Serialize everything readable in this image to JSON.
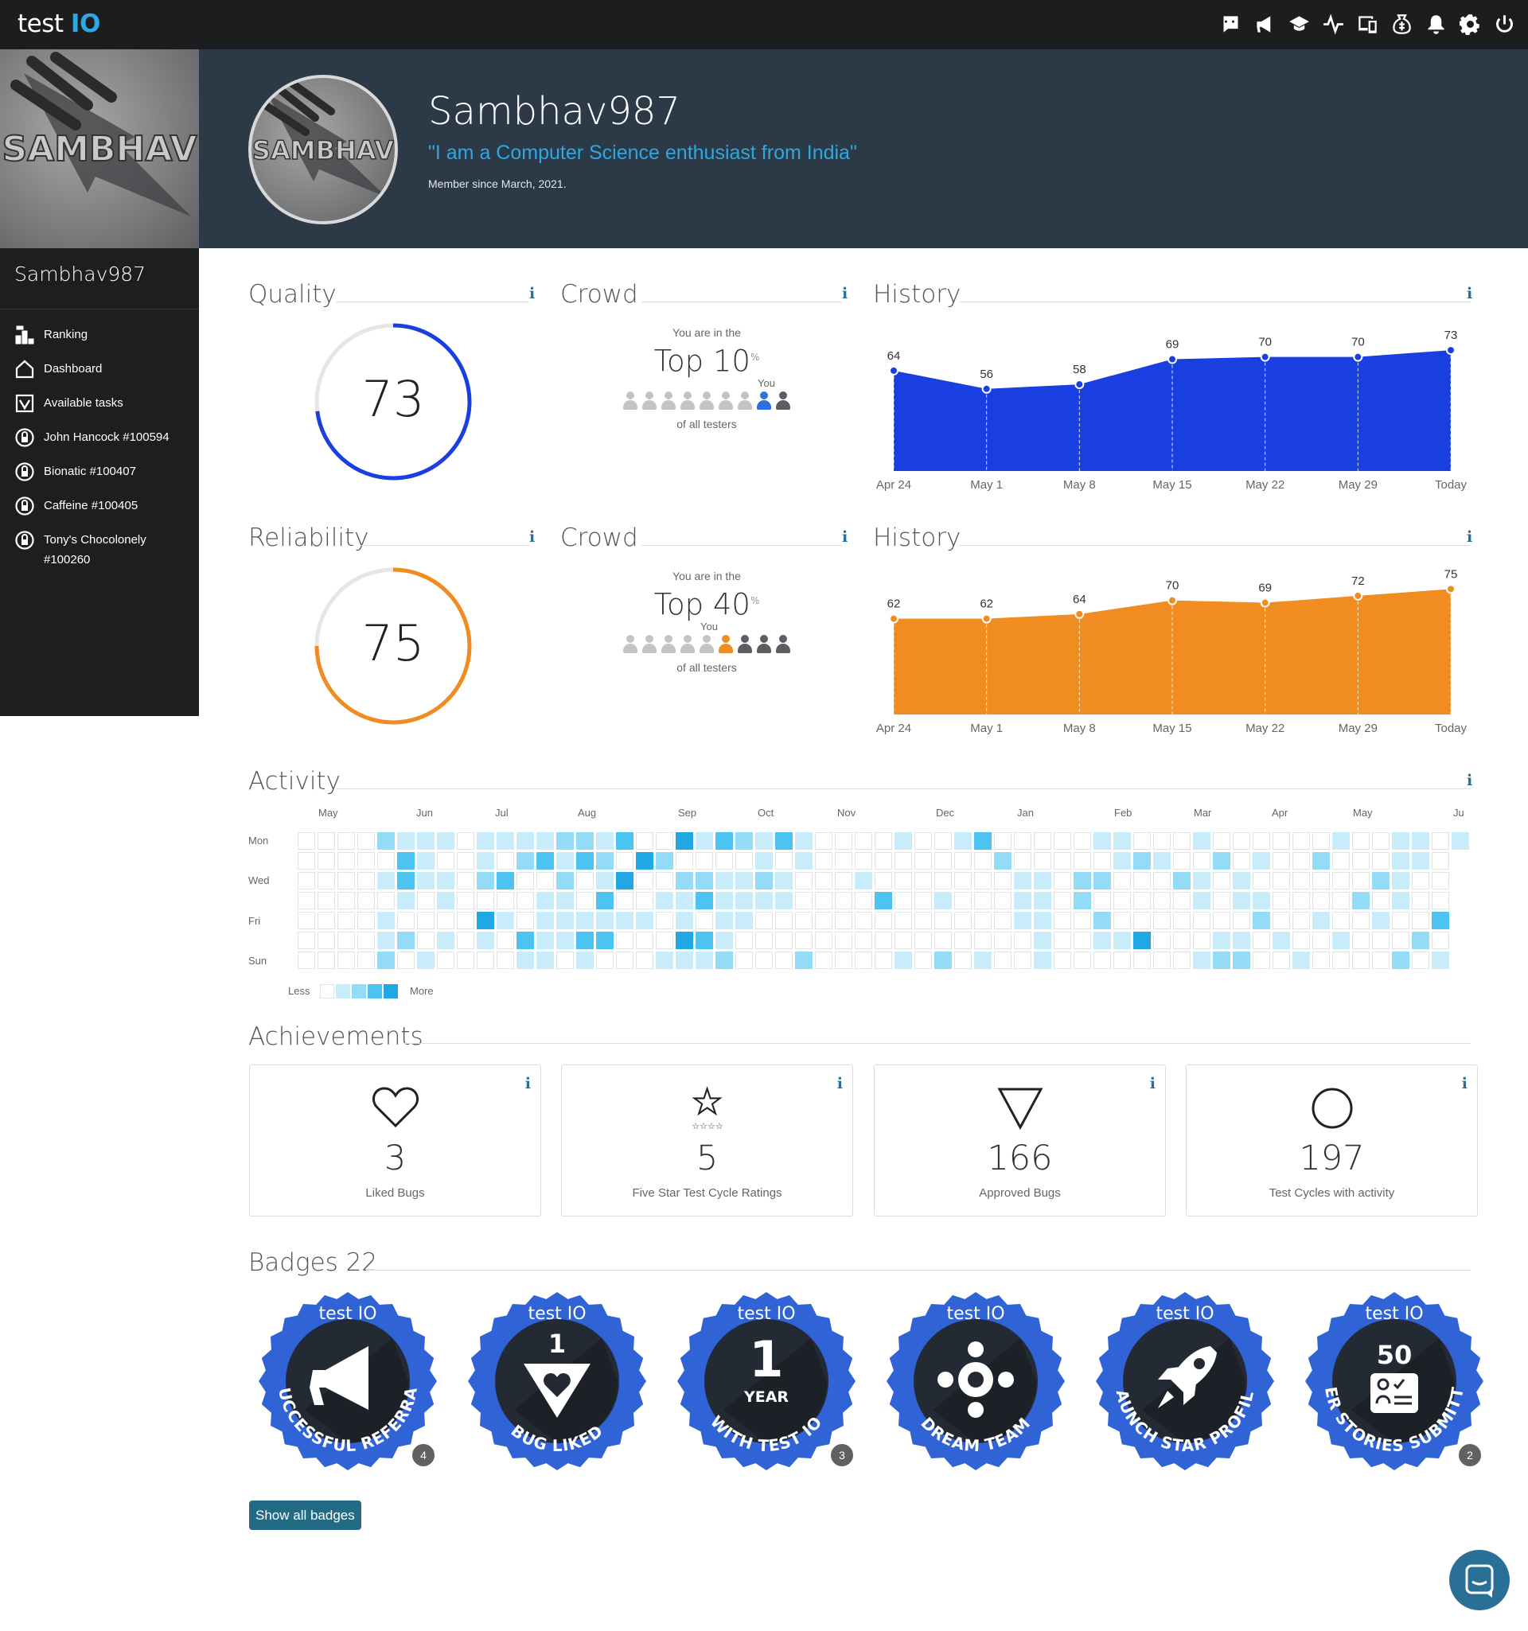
{
  "app": {
    "logo_text": "test",
    "logo_accent": "IO"
  },
  "topbar": {
    "icons": [
      "discord-icon",
      "megaphone-icon",
      "graduation-cap-icon",
      "activity-icon",
      "devices-icon",
      "money-bag-icon",
      "bell-icon",
      "gear-icon",
      "power-icon"
    ]
  },
  "sidebar": {
    "username": "Sambhav987",
    "items": [
      {
        "label": "Ranking",
        "icon": "ranking-icon"
      },
      {
        "label": "Dashboard",
        "icon": "home-icon"
      },
      {
        "label": "Available tasks",
        "icon": "tasks-icon"
      },
      {
        "label": "John Hancock #100594",
        "icon": "lock-icon"
      },
      {
        "label": "Bionatic #100407",
        "icon": "lock-icon"
      },
      {
        "label": "Caffeine #100405",
        "icon": "lock-icon"
      },
      {
        "label": "Tony's Chocolonely #100260",
        "icon": "lock-icon"
      }
    ]
  },
  "avatar": {
    "text": "SAMBHAV"
  },
  "profile": {
    "name": "Sambhav987",
    "quote": "\"I am a Computer Science enthusiast from India\"",
    "member_since": "Member since March, 2021."
  },
  "quality": {
    "title": "Quality",
    "value": "73",
    "ring_fraction": 0.73,
    "color": "#1a3fe0",
    "crowd": {
      "title": "Crowd",
      "prefix": "You are in the",
      "top": "Top 10",
      "pct": "%",
      "you": "You",
      "suffix": "of all testers",
      "position": 7
    },
    "history": {
      "title": "History",
      "chart_data": {
        "type": "area",
        "x": [
          "Apr 24",
          "May 1",
          "May 8",
          "May 15",
          "May 22",
          "May 29",
          "Today"
        ],
        "values": [
          64,
          56,
          58,
          69,
          70,
          70,
          73
        ],
        "color": "#1a3fe0"
      }
    }
  },
  "reliability": {
    "title": "Reliability",
    "value": "75",
    "ring_fraction": 0.75,
    "color": "#f08c20",
    "crowd": {
      "title": "Crowd",
      "prefix": "You are in the",
      "top": "Top 40",
      "pct": "%",
      "you": "You",
      "suffix": "of all testers",
      "position": 5
    },
    "history": {
      "title": "History",
      "chart_data": {
        "type": "area",
        "x": [
          "Apr 24",
          "May 1",
          "May 8",
          "May 15",
          "May 22",
          "May 29",
          "Today"
        ],
        "values": [
          62,
          62,
          64,
          70,
          69,
          72,
          75
        ],
        "color": "#f08c20"
      }
    }
  },
  "activity": {
    "title": "Activity",
    "months": [
      "May",
      "Jun",
      "Jul",
      "Aug",
      "Sep",
      "Oct",
      "Nov",
      "Dec",
      "Jan",
      "Feb",
      "Mar",
      "Apr",
      "May",
      "Ju"
    ],
    "days": [
      "Mon",
      "Wed",
      "Fri",
      "Sun"
    ],
    "legend_less": "Less",
    "legend_more": "More",
    "colors": [
      "#ffffff",
      "#c9ecfb",
      "#93dbf7",
      "#4cc3f0",
      "#1fa8e3"
    ]
  },
  "achievements": {
    "title": "Achievements",
    "cards": [
      {
        "value": "3",
        "label": "Liked Bugs",
        "icon": "heart-icon"
      },
      {
        "value": "5",
        "label": "Five Star Test Cycle Ratings",
        "icon": "star-icon"
      },
      {
        "value": "166",
        "label": "Approved Bugs",
        "icon": "triangle-icon"
      },
      {
        "value": "197",
        "label": "Test Cycles with activity",
        "icon": "circle-icon"
      }
    ]
  },
  "badges": {
    "title": "Badges 22",
    "brand": "test IO",
    "items": [
      {
        "label": "SUCCESSFUL REFERRAL",
        "center": "",
        "count": "4",
        "icon": "megaphone-icon"
      },
      {
        "label": "BUG LIKED",
        "center": "1",
        "count": "",
        "icon": "heart-triangle-icon"
      },
      {
        "label": "WITH TEST IO",
        "center": "1",
        "center2": "YEAR",
        "count": "3",
        "icon": "year-icon"
      },
      {
        "label": "DREAM TEAM",
        "center": "",
        "count": "",
        "icon": "team-icon"
      },
      {
        "label": "LAUNCH STAR PROFILE",
        "center": "",
        "count": "",
        "icon": "rocket-icon"
      },
      {
        "label": "USER STORIES SUBMITTED",
        "center": "50",
        "count": "2",
        "icon": "stories-icon"
      }
    ],
    "show_all": "Show all badges"
  }
}
